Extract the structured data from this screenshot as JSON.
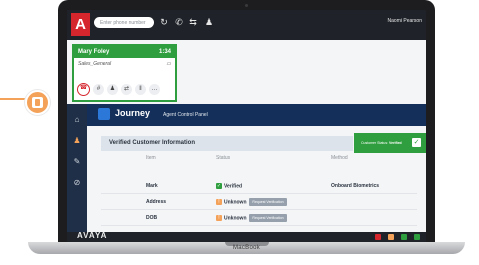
{
  "brand": "MacBook",
  "topbar": {
    "logo_letter": "A",
    "phone_placeholder": "Enter phone number",
    "user_name": "Naomi Pearson"
  },
  "call": {
    "caller": "Mary Foley",
    "duration": "1:34",
    "queue": "Sales_General"
  },
  "journey": {
    "app_name": "Journey",
    "panel_name": "Agent Control Panel"
  },
  "verification": {
    "title": "Verified Customer Information",
    "customer_status_label": "Customer Status:",
    "customer_status_value": "Verified",
    "columns": [
      "Item",
      "Status",
      "Method"
    ],
    "rows": [
      {
        "item": "Mark",
        "status": "Verified",
        "status_type": "ok",
        "method": "Onboard Biometrics",
        "action": ""
      },
      {
        "item": "Address",
        "status": "Unknown",
        "status_type": "warn",
        "method": "",
        "action": "Request Verification"
      },
      {
        "item": "DOB",
        "status": "Unknown",
        "status_type": "warn",
        "method": "",
        "action": "Request Verification"
      }
    ]
  },
  "footer": {
    "logo": "AVAYA"
  },
  "colors": {
    "avaya_red": "#d5262d",
    "call_green": "#2e9e3e",
    "journey_navy": "#14305a",
    "connector_orange": "#f4a259"
  }
}
